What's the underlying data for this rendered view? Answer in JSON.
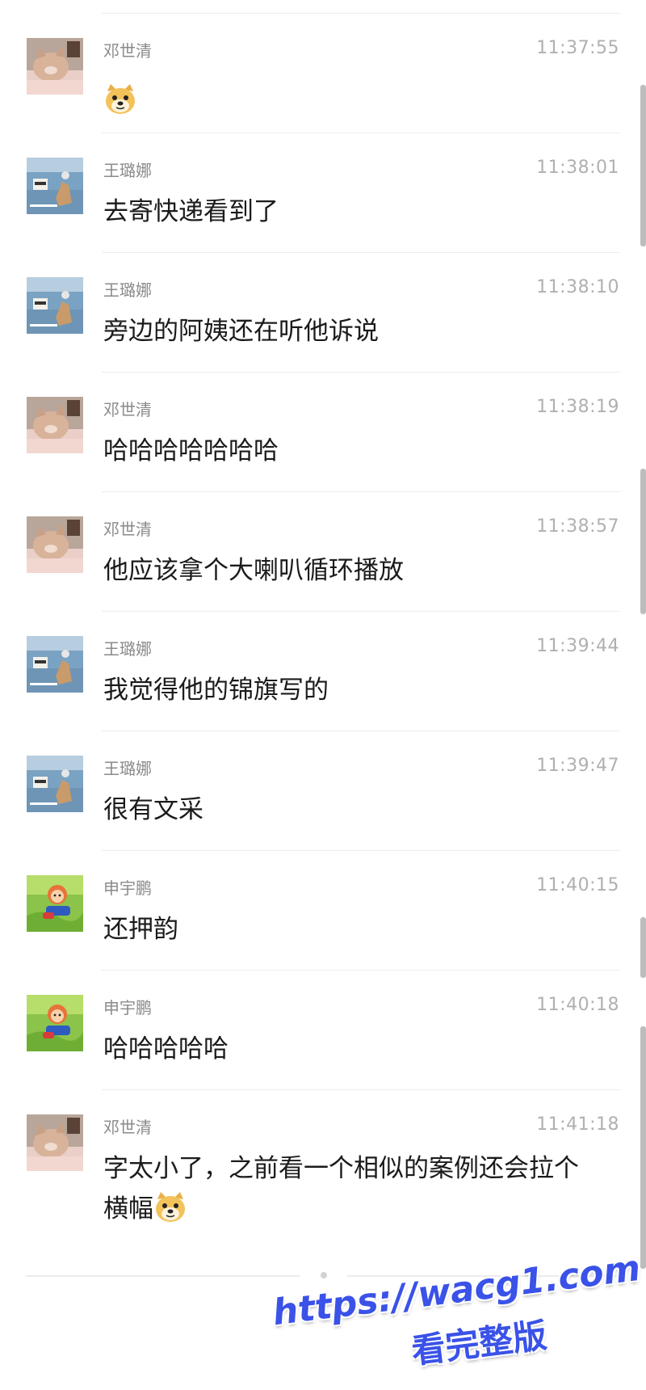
{
  "colors": {
    "name": "#8a8a8a",
    "time": "#b0b0b0",
    "text": "#1b1b1b",
    "divider": "#ededed",
    "watermark": "#3a52e8"
  },
  "messages": [
    {
      "sender": "邓世清",
      "time": "11:37:55",
      "text": "",
      "avatar": "cat-avatar",
      "emoji": "doge-emoji"
    },
    {
      "sender": "王璐娜",
      "time": "11:38:01",
      "text": "去寄快递看到了",
      "avatar": "lake-avatar"
    },
    {
      "sender": "王璐娜",
      "time": "11:38:10",
      "text": "旁边的阿姨还在听他诉说",
      "avatar": "lake-avatar"
    },
    {
      "sender": "邓世清",
      "time": "11:38:19",
      "text": "哈哈哈哈哈哈哈",
      "avatar": "cat-avatar"
    },
    {
      "sender": "邓世清",
      "time": "11:38:57",
      "text": "他应该拿个大喇叭循环播放",
      "avatar": "cat-avatar"
    },
    {
      "sender": "王璐娜",
      "time": "11:39:44",
      "text": "我觉得他的锦旗写的",
      "avatar": "lake-avatar"
    },
    {
      "sender": "王璐娜",
      "time": "11:39:47",
      "text": "很有文采",
      "avatar": "lake-avatar"
    },
    {
      "sender": "申宇鹏",
      "time": "11:40:15",
      "text": "还押韵",
      "avatar": "cartoon-avatar"
    },
    {
      "sender": "申宇鹏",
      "time": "11:40:18",
      "text": "哈哈哈哈哈",
      "avatar": "cartoon-avatar"
    },
    {
      "sender": "邓世清",
      "time": "11:41:18",
      "text": "字太小了，之前看一个相似的案例还会拉个横幅",
      "avatar": "cat-avatar",
      "emoji": "doge-emoji"
    }
  ],
  "watermark": {
    "url": "https://wacg1.com",
    "subtitle": "看完整版"
  }
}
